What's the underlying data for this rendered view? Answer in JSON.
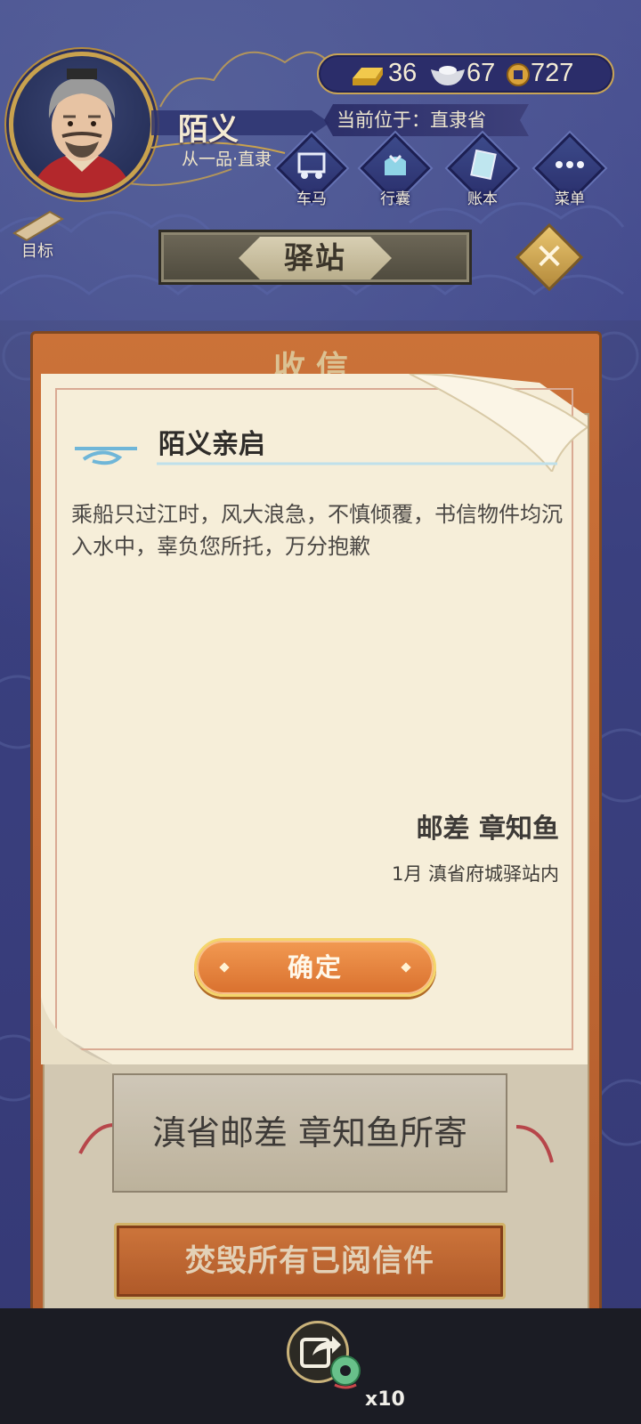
{
  "player": {
    "name": "陌义",
    "rank": "从一品·直隶"
  },
  "currency": {
    "gold": "36",
    "silver": "67",
    "coins": "727"
  },
  "location": {
    "label": "当前位于：直隶省"
  },
  "nav": {
    "items": [
      {
        "label": "车马",
        "icon": "carriage-icon"
      },
      {
        "label": "行囊",
        "icon": "bag-icon"
      },
      {
        "label": "账本",
        "icon": "ledger-icon"
      },
      {
        "label": "菜单",
        "icon": "menu-icon"
      }
    ]
  },
  "goal": {
    "label": "目标"
  },
  "screen": {
    "title": "驿站",
    "back_title": "收信"
  },
  "letter": {
    "heading": "陌义亲启",
    "body": "乘船只过江时，风大浪急，不慎倾覆，书信物件均沉入水中，辜负您所托，万分抱歉",
    "signature": "邮差 章知鱼",
    "date_place": "1月 滇省府城驿站内",
    "confirm_label": "确定"
  },
  "mail_item": {
    "label": "滇省邮差 章知鱼所寄"
  },
  "burn_button": {
    "label": "焚毁所有已阅信件"
  },
  "bottom": {
    "multiplier": "x10"
  },
  "colors": {
    "accent_gold": "#c9a24e",
    "panel_orange": "#e07a36",
    "paper": "#f6eed9"
  }
}
